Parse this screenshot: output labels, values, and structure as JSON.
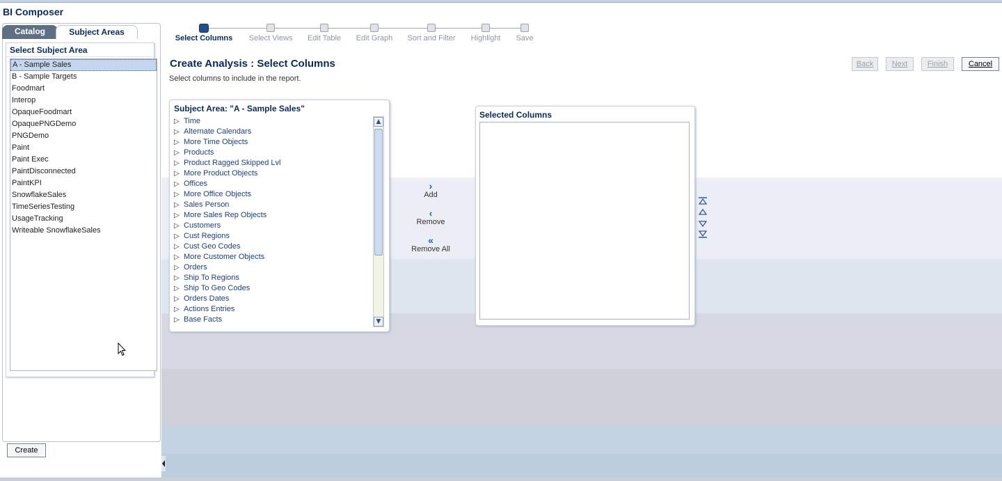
{
  "app": {
    "title": "BI Composer"
  },
  "tabs": {
    "catalog": "Catalog",
    "subject_areas": "Subject Areas"
  },
  "subject_panel": {
    "heading": "Select Subject Area",
    "items": [
      "A - Sample Sales",
      "B - Sample Targets",
      "Foodmart",
      "Interop",
      "OpaqueFoodmart",
      "OpaquePNGDemo",
      "PNGDemo",
      "Paint",
      "Paint Exec",
      "PaintDisconnected",
      "PaintKPI",
      "SnowflakeSales",
      "TimeSeriesTesting",
      "UsageTracking",
      "Writeable SnowflakeSales"
    ],
    "selected_index": 0
  },
  "create_button": "Create",
  "train": {
    "steps": [
      "Select Columns",
      "Select Views",
      "Edit Table",
      "Edit Graph",
      "Sort and Filter",
      "Highlight",
      "Save"
    ],
    "active_index": 0
  },
  "page": {
    "heading": "Create Analysis : Select Columns",
    "subheading": "Select columns to include in the report."
  },
  "nav_buttons": {
    "back": "Back",
    "next": "Next",
    "finish": "Finish",
    "cancel": "Cancel"
  },
  "tree": {
    "heading": "Subject Area: \"A - Sample Sales\"",
    "items": [
      "Time",
      "Alternate Calendars",
      "More Time Objects",
      "Products",
      "Product Ragged Skipped Lvl",
      "More Product Objects",
      "Offices",
      "More Office Objects",
      "Sales Person",
      "More Sales Rep Objects",
      "Customers",
      "Cust Regions",
      "Cust Geo Codes",
      "More Customer Objects",
      "Orders",
      "Ship To Regions",
      "Ship To Geo Codes",
      "Orders Dates",
      "Actions Entries",
      "Base Facts"
    ]
  },
  "shuttle": {
    "add": "Add",
    "remove": "Remove",
    "remove_all": "Remove All"
  },
  "selected_columns": {
    "heading": "Selected Columns"
  }
}
